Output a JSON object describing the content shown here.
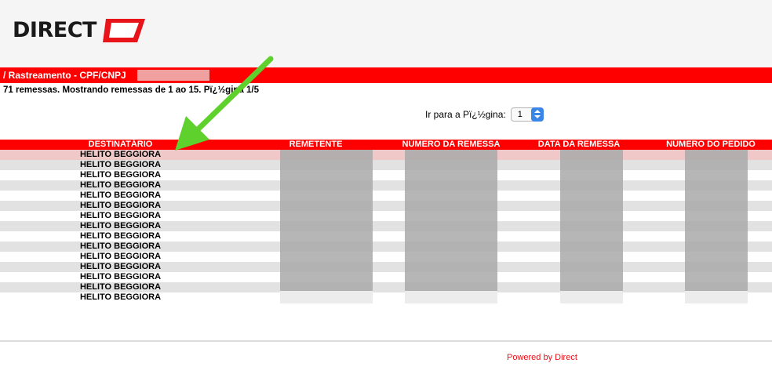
{
  "brand": {
    "name": "DIRECT",
    "accent": "#e8141a"
  },
  "breadcrumb": {
    "text": "/ Rastreamento - CPF/CNPJ"
  },
  "summary": {
    "text": "71 remessas. Mostrando remessas de 1 ao 15. Pï¿½gina 1/5"
  },
  "pager": {
    "label": "Ir para a Pï¿½gina:",
    "selected": "1"
  },
  "table": {
    "columns": [
      "DESTINATÁRIO",
      "REMETENTE",
      "NÚMERO DA REMESSA",
      "DATA DA REMESSA",
      "NÚMERO DO PEDIDO"
    ],
    "rows": [
      "HELITO BEGGIORA",
      "HELITO BEGGIORA",
      "HELITO BEGGIORA",
      "HELITO BEGGIORA",
      "HELITO BEGGIORA",
      "HELITO BEGGIORA",
      "HELITO BEGGIORA",
      "HELITO BEGGIORA",
      "HELITO BEGGIORA",
      "HELITO BEGGIORA",
      "HELITO BEGGIORA",
      "HELITO BEGGIORA",
      "HELITO BEGGIORA",
      "HELITO BEGGIORA",
      "HELITO BEGGIORA"
    ]
  },
  "footer": {
    "text": "Powered by Direct"
  },
  "annotation": {
    "arrow_color": "#5fd12c"
  }
}
